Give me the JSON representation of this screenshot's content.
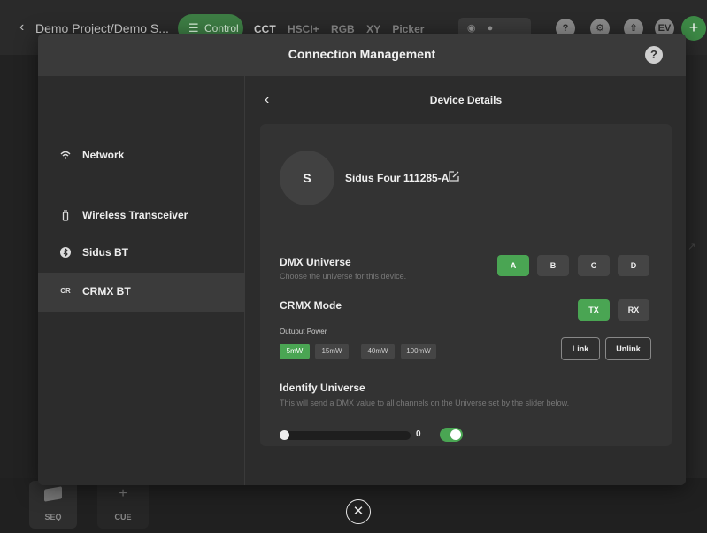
{
  "topbar": {
    "project_title": "Demo Project/Demo S...",
    "control_label": "Control",
    "tabs": [
      "CCT",
      "HSCI+",
      "RGB",
      "XY",
      "Picker"
    ],
    "avatar_initials": "EV"
  },
  "bottombar": {
    "seq_label": "SEQ",
    "cue_label": "CUE"
  },
  "modal": {
    "title": "Connection Management",
    "help": "?",
    "nav": [
      {
        "label": "Network",
        "icon": "wifi-icon"
      },
      {
        "label": "Wireless Transceiver",
        "icon": "transceiver-icon"
      },
      {
        "label": "Sidus BT",
        "icon": "bluetooth-icon"
      },
      {
        "label": "CRMX BT",
        "icon_text": "CR",
        "active": true
      }
    ],
    "details": {
      "title": "Device Details",
      "avatar_letter": "S",
      "device_name": "Sidus Four 111285-A",
      "dmx": {
        "title": "DMX Universe",
        "desc": "Choose the universe for this device.",
        "options": [
          "A",
          "B",
          "C",
          "D"
        ],
        "selected": "A"
      },
      "crmx": {
        "title": "CRMX Mode",
        "options": [
          "TX",
          "RX"
        ],
        "selected": "TX",
        "power_label": "Outuput Power",
        "power_options": [
          "5mW",
          "15mW",
          "40mW",
          "100mW"
        ],
        "power_selected": "5mW",
        "link_label": "Link",
        "unlink_label": "Unlink"
      },
      "identify": {
        "title": "Identify Universe",
        "desc": "This will send a DMX value to all channels on the Universe set by the slider below.",
        "slider_value": "0",
        "toggle_on": true
      }
    }
  },
  "colors": {
    "accent_green": "#4aa553",
    "modal_bg": "#2c2c2c",
    "card_bg": "#333333"
  }
}
